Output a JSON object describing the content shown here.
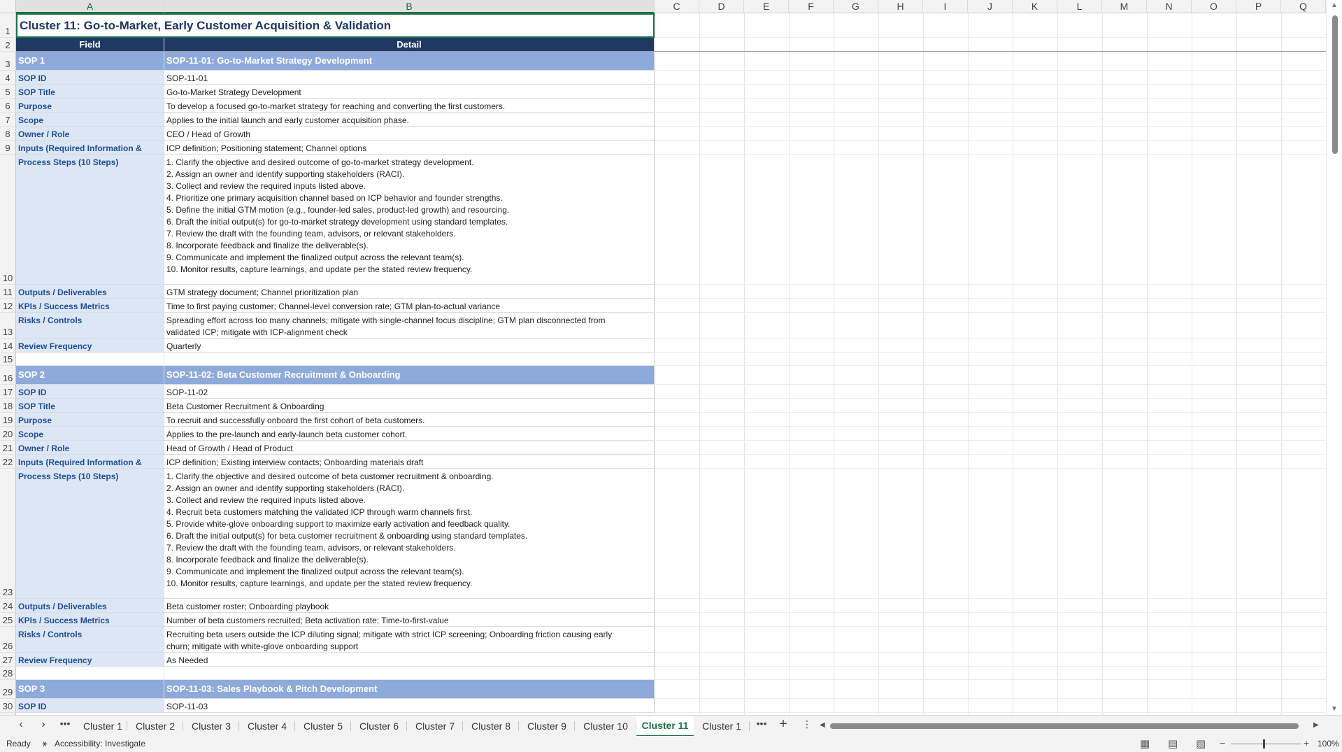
{
  "columns": [
    "A",
    "B",
    "C",
    "D",
    "E",
    "F",
    "G",
    "H",
    "I",
    "J",
    "K",
    "L",
    "M",
    "N",
    "O",
    "P",
    "Q"
  ],
  "sheet": {
    "title": "Cluster 11: Go-to-Market, Early Customer Acquisition & Validation",
    "header_field": "Field",
    "header_detail": "Detail",
    "sop1": {
      "band_label": "SOP 1",
      "band_title": "SOP-11-01: Go-to-Market Strategy Development",
      "rows": [
        {
          "field": "SOP ID",
          "detail": "SOP-11-01"
        },
        {
          "field": "SOP Title",
          "detail": "Go-to-Market Strategy Development"
        },
        {
          "field": "Purpose",
          "detail": "To develop a focused go-to-market strategy for reaching and converting the first customers."
        },
        {
          "field": "Scope",
          "detail": "Applies to the initial launch and early customer acquisition phase."
        },
        {
          "field": "Owner / Role",
          "detail": "CEO / Head of Growth"
        },
        {
          "field": "Inputs (Required Information &",
          "detail": "ICP definition; Positioning statement; Channel options"
        }
      ],
      "process_field": "Process Steps (10 Steps)",
      "steps": [
        "1. Clarify the objective and desired outcome of go-to-market strategy development.",
        "2. Assign an owner and identify supporting stakeholders (RACI).",
        "3. Collect and review the required inputs listed above.",
        "4. Prioritize one primary acquisition channel based on ICP behavior and founder strengths.",
        "5. Define the initial GTM motion (e.g., founder-led sales, product-led growth) and resourcing.",
        "6. Draft the initial output(s) for go-to-market strategy development using standard templates.",
        "7. Review the draft with the founding team, advisors, or relevant stakeholders.",
        "8. Incorporate feedback and finalize the deliverable(s).",
        "9. Communicate and implement the finalized output across the relevant team(s).",
        "10. Monitor results, capture learnings, and update per the stated review frequency."
      ],
      "outputs": {
        "field": "Outputs / Deliverables",
        "detail": "GTM strategy document; Channel prioritization plan"
      },
      "kpis": {
        "field": "KPIs / Success Metrics",
        "detail": "Time to first paying customer; Channel-level conversion rate; GTM plan-to-actual variance"
      },
      "risks": {
        "field": "Risks / Controls",
        "line1": "Spreading effort across too many channels; mitigate with single-channel focus discipline; GTM plan disconnected from",
        "line2": "validated ICP; mitigate with ICP-alignment check"
      },
      "review": {
        "field": "Review Frequency",
        "detail": "Quarterly"
      }
    },
    "sop2": {
      "band_label": "SOP 2",
      "band_title": "SOP-11-02: Beta Customer Recruitment & Onboarding",
      "rows": [
        {
          "field": "SOP ID",
          "detail": "SOP-11-02"
        },
        {
          "field": "SOP Title",
          "detail": "Beta Customer Recruitment & Onboarding"
        },
        {
          "field": "Purpose",
          "detail": "To recruit and successfully onboard the first cohort of beta customers."
        },
        {
          "field": "Scope",
          "detail": "Applies to the pre-launch and early-launch beta customer cohort."
        },
        {
          "field": "Owner / Role",
          "detail": "Head of Growth / Head of Product"
        },
        {
          "field": "Inputs (Required Information &",
          "detail": "ICP definition; Existing interview contacts; Onboarding materials draft"
        }
      ],
      "process_field": "Process Steps (10 Steps)",
      "steps": [
        "1. Clarify the objective and desired outcome of beta customer recruitment & onboarding.",
        "2. Assign an owner and identify supporting stakeholders (RACI).",
        "3. Collect and review the required inputs listed above.",
        "4. Recruit beta customers matching the validated ICP through warm channels first.",
        "5. Provide white-glove onboarding support to maximize early activation and feedback quality.",
        "6. Draft the initial output(s) for beta customer recruitment & onboarding using standard templates.",
        "7. Review the draft with the founding team, advisors, or relevant stakeholders.",
        "8. Incorporate feedback and finalize the deliverable(s).",
        "9. Communicate and implement the finalized output across the relevant team(s).",
        "10. Monitor results, capture learnings, and update per the stated review frequency."
      ],
      "outputs": {
        "field": "Outputs / Deliverables",
        "detail": "Beta customer roster; Onboarding playbook"
      },
      "kpis": {
        "field": "KPIs / Success Metrics",
        "detail": "Number of beta customers recruited; Beta activation rate; Time-to-first-value"
      },
      "risks": {
        "field": "Risks / Controls",
        "line1": "Recruiting beta users outside the ICP diluting signal; mitigate with strict ICP screening; Onboarding friction causing early",
        "line2": "churn; mitigate with white-glove onboarding support"
      },
      "review": {
        "field": "Review Frequency",
        "detail": "As Needed"
      }
    },
    "sop3": {
      "band_label": "SOP 3",
      "band_title": "SOP-11-03: Sales Playbook & Pitch Development",
      "rows": [
        {
          "field": "SOP ID",
          "detail": "SOP-11-03"
        }
      ]
    }
  },
  "tabs": {
    "items": [
      "Cluster 1",
      "Cluster 2",
      "Cluster 3",
      "Cluster 4",
      "Cluster 5",
      "Cluster 6",
      "Cluster 7",
      "Cluster 8",
      "Cluster 9",
      "Cluster 10",
      "Cluster 11",
      "Cluster 1"
    ],
    "active_index": 10
  },
  "status": {
    "ready": "Ready",
    "accessibility": "Accessibility: Investigate",
    "zoom": "100%"
  },
  "colors": {
    "title_text": "#1f3864",
    "header_bg": "#1f3864",
    "band_bg": "#8eaadb",
    "field_bg": "#dce6f5",
    "field_text": "#1f4e96",
    "active_tab": "#1e7145"
  }
}
